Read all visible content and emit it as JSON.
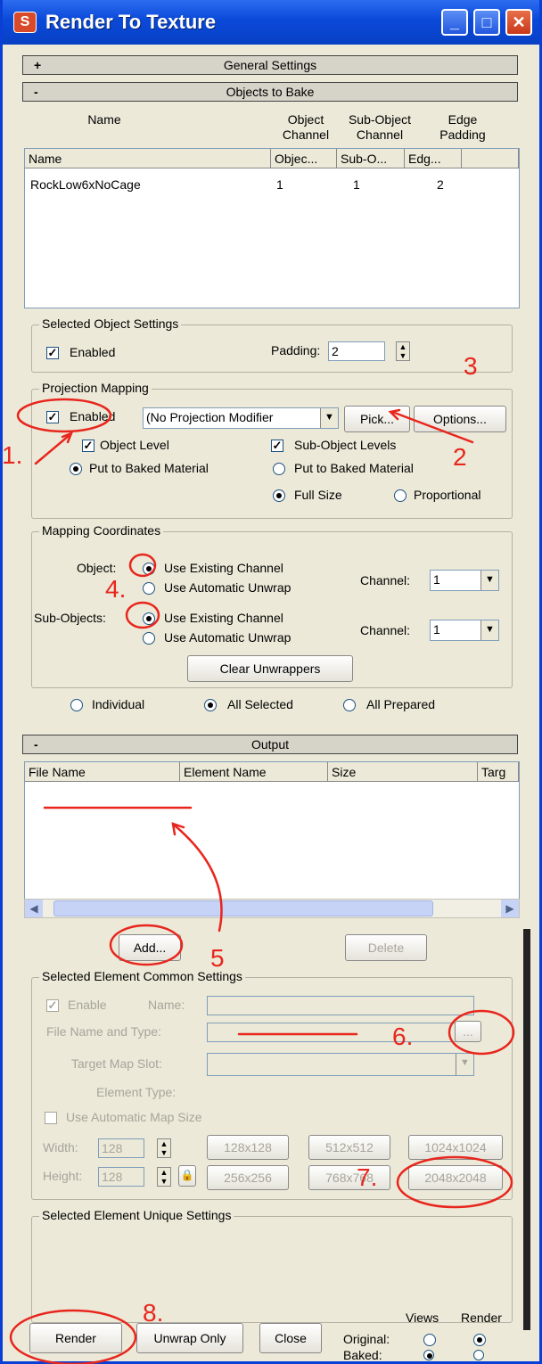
{
  "window": {
    "title": "Render To Texture"
  },
  "rollouts": {
    "general": {
      "label": "General Settings",
      "sign": "+"
    },
    "objects": {
      "label": "Objects to Bake",
      "sign": "-"
    },
    "output": {
      "label": "Output",
      "sign": "-"
    }
  },
  "objects_table": {
    "headers_top": [
      {
        "l1": "",
        "l2": "Name"
      },
      {
        "l1": "Object",
        "l2": "Channel"
      },
      {
        "l1": "Sub-Object",
        "l2": "Channel"
      },
      {
        "l1": "Edge",
        "l2": "Padding"
      }
    ],
    "columns": [
      "Name",
      "Objec...",
      "Sub-O...",
      "Edg..."
    ],
    "rows": [
      {
        "name": "RockLow6xNoCage",
        "obj": "1",
        "sub": "1",
        "edge": "2"
      }
    ]
  },
  "selected_object": {
    "group": "Selected Object Settings",
    "enabled_label": "Enabled",
    "padding_label": "Padding:",
    "padding_value": "2"
  },
  "projection": {
    "group": "Projection Mapping",
    "enabled_label": "Enabled",
    "modifier": "(No Projection Modifier",
    "pick": "Pick...",
    "options": "Options...",
    "object_level": "Object Level",
    "sub_object_levels": "Sub-Object Levels",
    "put_baked_1": "Put to Baked Material",
    "put_baked_2": "Put to Baked Material",
    "full_size": "Full Size",
    "proportional": "Proportional"
  },
  "mapping": {
    "group": "Mapping Coordinates",
    "object_label": "Object:",
    "sub_label": "Sub-Objects:",
    "use_existing": "Use Existing Channel",
    "use_auto": "Use Automatic Unwrap",
    "use_existing_2": "Use Existing Channel",
    "use_auto_2": "Use Automatic Unwrap",
    "channel_label": "Channel:",
    "channel_label_2": "Channel:",
    "channel_value": "1",
    "channel_value_2": "1",
    "clear": "Clear Unwrappers"
  },
  "bake_scope": {
    "individual": "Individual",
    "all_selected": "All Selected",
    "all_prepared": "All Prepared"
  },
  "output_table": {
    "columns": [
      "File Name",
      "Element Name",
      "Size",
      "Targ"
    ]
  },
  "output_buttons": {
    "add": "Add...",
    "delete": "Delete"
  },
  "element_common": {
    "group": "Selected Element Common Settings",
    "enable": "Enable",
    "name_label": "Name:",
    "file_label": "File Name and Type:",
    "target_label": "Target Map Slot:",
    "element_type": "Element Type:",
    "auto_size": "Use Automatic Map Size",
    "width_label": "Width:",
    "height_label": "Height:",
    "width": "128",
    "height": "128",
    "sizes": [
      "128x128",
      "512x512",
      "1024x1024",
      "256x256",
      "768x768",
      "2048x2048"
    ]
  },
  "element_unique": {
    "group": "Selected Element Unique Settings"
  },
  "footer": {
    "render": "Render",
    "unwrap": "Unwrap Only",
    "close": "Close",
    "views": "Views",
    "render_col": "Render",
    "original": "Original:",
    "baked": "Baked:"
  },
  "annotations": {
    "n1": "1.",
    "n2": "2",
    "n3": "3",
    "n4": "4.",
    "n5": "5",
    "n6": "6.",
    "n7": "7.",
    "n8": "8.",
    "color": "#e8261d"
  }
}
